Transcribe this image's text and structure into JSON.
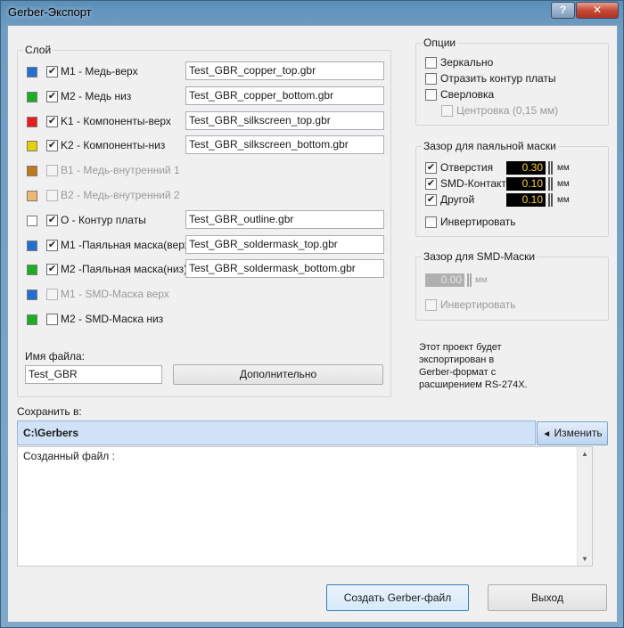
{
  "window": {
    "title": "Gerber-Экспорт",
    "help_label": "?",
    "close_label": "✕"
  },
  "layers": {
    "group_title": "Слой",
    "items": [
      {
        "color": "#1f6fd6",
        "checked": true,
        "enabled": true,
        "label": "M1 - Медь-верх",
        "filename": "Test_GBR_copper_top.gbr"
      },
      {
        "color": "#19b020",
        "checked": true,
        "enabled": true,
        "label": "M2 - Медь низ",
        "filename": "Test_GBR_copper_bottom.gbr"
      },
      {
        "color": "#ef1a1a",
        "checked": true,
        "enabled": true,
        "label": "K1 - Компоненты-верх",
        "filename": "Test_GBR_silkscreen_top.gbr"
      },
      {
        "color": "#e8d000",
        "checked": true,
        "enabled": true,
        "label": "K2 - Компоненты-низ",
        "filename": "Test_GBR_silkscreen_bottom.gbr"
      },
      {
        "color": "#c07a1c",
        "checked": false,
        "enabled": false,
        "label": "B1 - Медь-внутренний 1",
        "filename": ""
      },
      {
        "color": "#efb870",
        "checked": false,
        "enabled": false,
        "label": "B2 - Медь-внутренний 2",
        "filename": ""
      },
      {
        "color": "#ffffff",
        "checked": true,
        "enabled": true,
        "label": "O - Контур платы",
        "filename": "Test_GBR_outline.gbr"
      },
      {
        "color": "#1f6fd6",
        "checked": true,
        "enabled": true,
        "label": "M1 -Паяльная маска(верх)",
        "filename": "Test_GBR_soldermask_top.gbr"
      },
      {
        "color": "#19b020",
        "checked": true,
        "enabled": true,
        "label": "M2 -Паяльная маска(низ)",
        "filename": "Test_GBR_soldermask_bottom.gbr"
      },
      {
        "color": "#1f6fd6",
        "checked": false,
        "enabled": false,
        "label": "M1 - SMD-Маска верх",
        "filename": ""
      },
      {
        "color": "#19b020",
        "checked": false,
        "enabled": true,
        "label": "M2 - SMD-Маска низ",
        "filename": ""
      }
    ],
    "filename_label": "Имя файла:",
    "filename_value": "Test_GBR",
    "advanced_button": "Дополнительно"
  },
  "options": {
    "group_title": "Опции",
    "mirror": "Зеркально",
    "board_outline": "Отразить контур платы",
    "drilling": "Сверловка",
    "centering": "Центровка (0,15 мм)"
  },
  "solder_clearance": {
    "group_title": "Зазор для паяльной маски",
    "rows": [
      {
        "label": "Отверстия",
        "value": "0.30",
        "unit": "мм"
      },
      {
        "label": "SMD-Контакт",
        "value": "0.10",
        "unit": "мм"
      },
      {
        "label": "Другой",
        "value": "0.10",
        "unit": "мм"
      }
    ],
    "invert": "Инвертировать"
  },
  "smd_clearance": {
    "group_title": "Зазор для SMD-Маски",
    "value": "0.00",
    "unit": "мм",
    "invert": "Инвертировать"
  },
  "info_text": [
    "Этот проект будет",
    "экспортирован в",
    "Gerber-формат с",
    "расширением RS-274X."
  ],
  "save": {
    "label": "Сохранить в:",
    "path": "C:\\Gerbers",
    "change_button": "Изменить",
    "log_text": "Созданный файл  :"
  },
  "actions": {
    "create": "Создать Gerber-файл",
    "exit": "Выход"
  }
}
